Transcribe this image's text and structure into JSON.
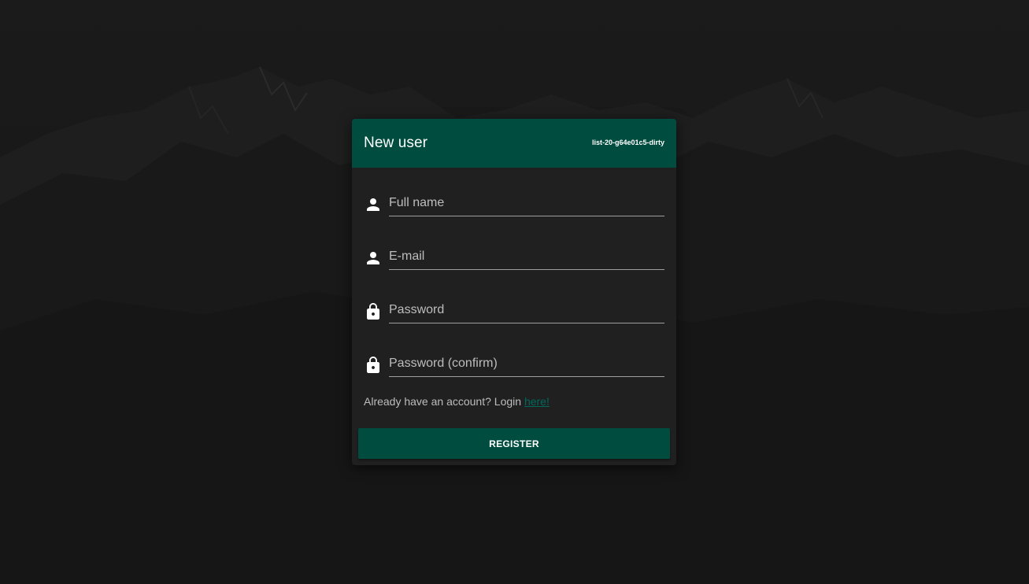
{
  "card": {
    "title": "New user",
    "version": "list-20-g64e01c5-dirty"
  },
  "fields": [
    {
      "icon": "person-icon",
      "placeholder": "Full name",
      "value": ""
    },
    {
      "icon": "person-icon",
      "placeholder": "E-mail",
      "value": ""
    },
    {
      "icon": "lock-icon",
      "placeholder": "Password",
      "value": ""
    },
    {
      "icon": "lock-icon",
      "placeholder": "Password (confirm)",
      "value": ""
    }
  ],
  "login": {
    "prompt": "Already have an account? Login ",
    "link_text": "here!"
  },
  "register": {
    "label": "REGISTER"
  },
  "colors": {
    "primary": "#004d40",
    "card_background": "#202020",
    "page_background": "#141514",
    "link": "#00695c",
    "text_muted": "#bdbdbd"
  }
}
